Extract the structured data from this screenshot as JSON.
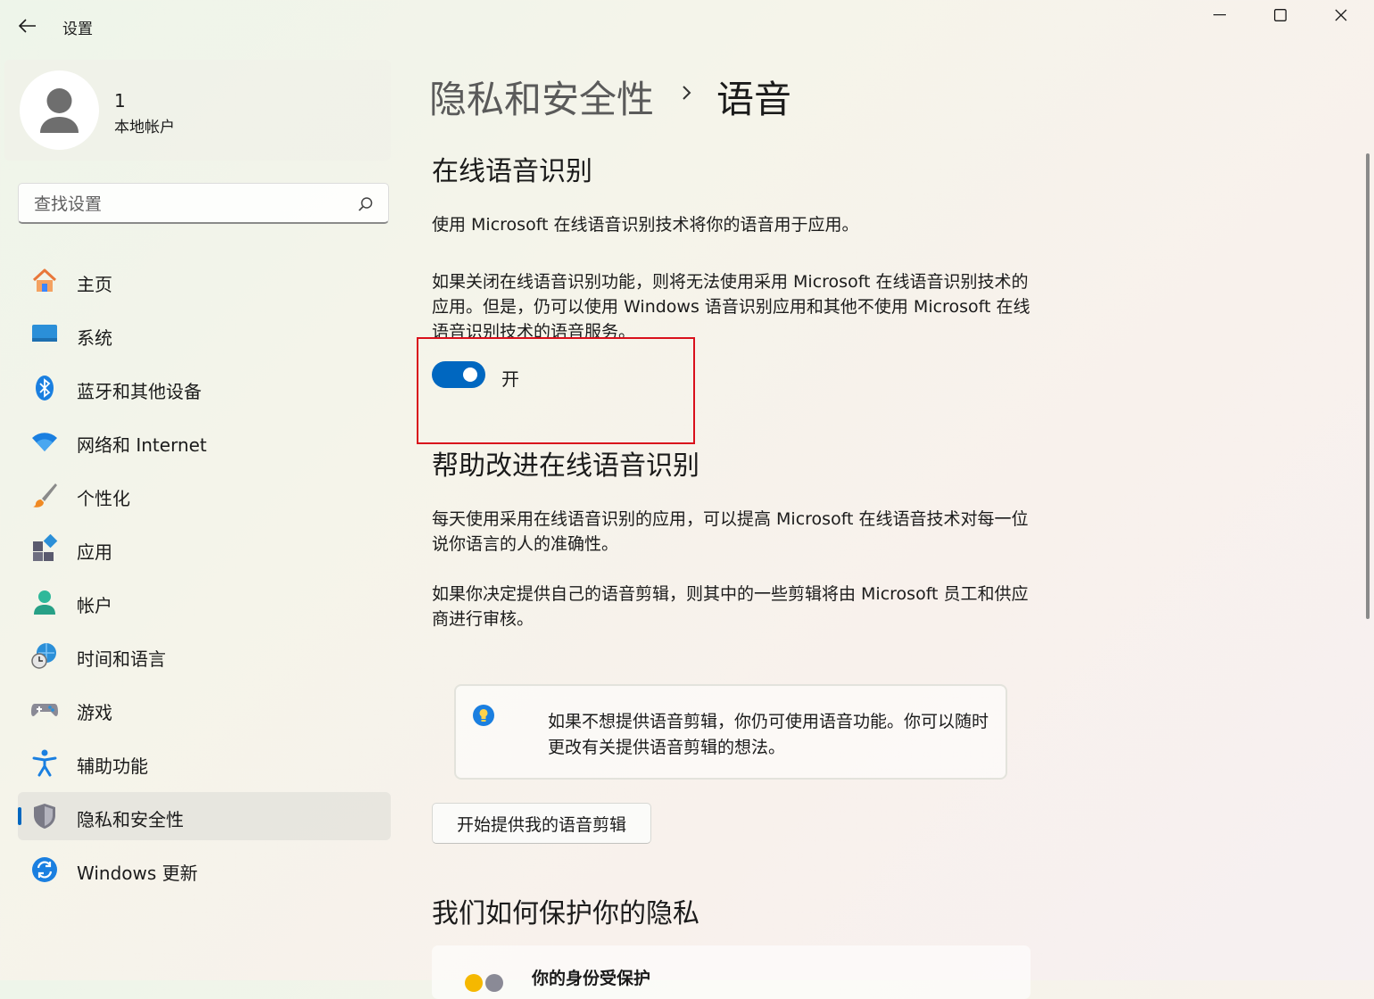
{
  "window": {
    "title": "设置"
  },
  "user": {
    "name": "1",
    "account_type": "本地帐户"
  },
  "search": {
    "placeholder": "查找设置",
    "value": ""
  },
  "nav": {
    "items": [
      {
        "label": "主页",
        "icon": "home-icon"
      },
      {
        "label": "系统",
        "icon": "system-display-icon"
      },
      {
        "label": "蓝牙和其他设备",
        "icon": "bluetooth-icon"
      },
      {
        "label": "网络和 Internet",
        "icon": "wifi-icon"
      },
      {
        "label": "个性化",
        "icon": "brush-icon"
      },
      {
        "label": "应用",
        "icon": "apps-icon"
      },
      {
        "label": "帐户",
        "icon": "account-icon"
      },
      {
        "label": "时间和语言",
        "icon": "globe-clock-icon"
      },
      {
        "label": "游戏",
        "icon": "gamepad-icon"
      },
      {
        "label": "辅助功能",
        "icon": "accessibility-icon"
      },
      {
        "label": "隐私和安全性",
        "icon": "shield-icon",
        "selected": true
      },
      {
        "label": "Windows 更新",
        "icon": "update-icon"
      }
    ]
  },
  "breadcrumb": {
    "parent": "隐私和安全性",
    "current": "语音"
  },
  "online_speech": {
    "title": "在线语音识别",
    "desc1": "使用 Microsoft 在线语音识别技术将你的语音用于应用。",
    "desc2": "如果关闭在线语音识别功能，则将无法使用采用 Microsoft 在线语音识别技术的应用。但是，仍可以使用 Windows 语音识别应用和其他不使用 Microsoft 在线语音识别技术的语音服务。",
    "toggle_label": "开",
    "toggle_on": true
  },
  "help_improve": {
    "title": "帮助改进在线语音识别",
    "desc1": "每天使用采用在线语音识别的应用，可以提高 Microsoft 在线语音技术对每一位说你语言的人的准确性。",
    "desc2": "如果你决定提供自己的语音剪辑，则其中的一些剪辑将由 Microsoft 员工和供应商进行审核。",
    "info_text": "如果不想提供语音剪辑，你仍可使用语音功能。你可以随时更改有关提供语音剪辑的想法。",
    "button_label": "开始提供我的语音剪辑"
  },
  "privacy": {
    "title": "我们如何保护你的隐私",
    "card_title": "你的身份受保护"
  },
  "colors": {
    "accent": "#0067c0",
    "highlight": "#d9101c"
  }
}
